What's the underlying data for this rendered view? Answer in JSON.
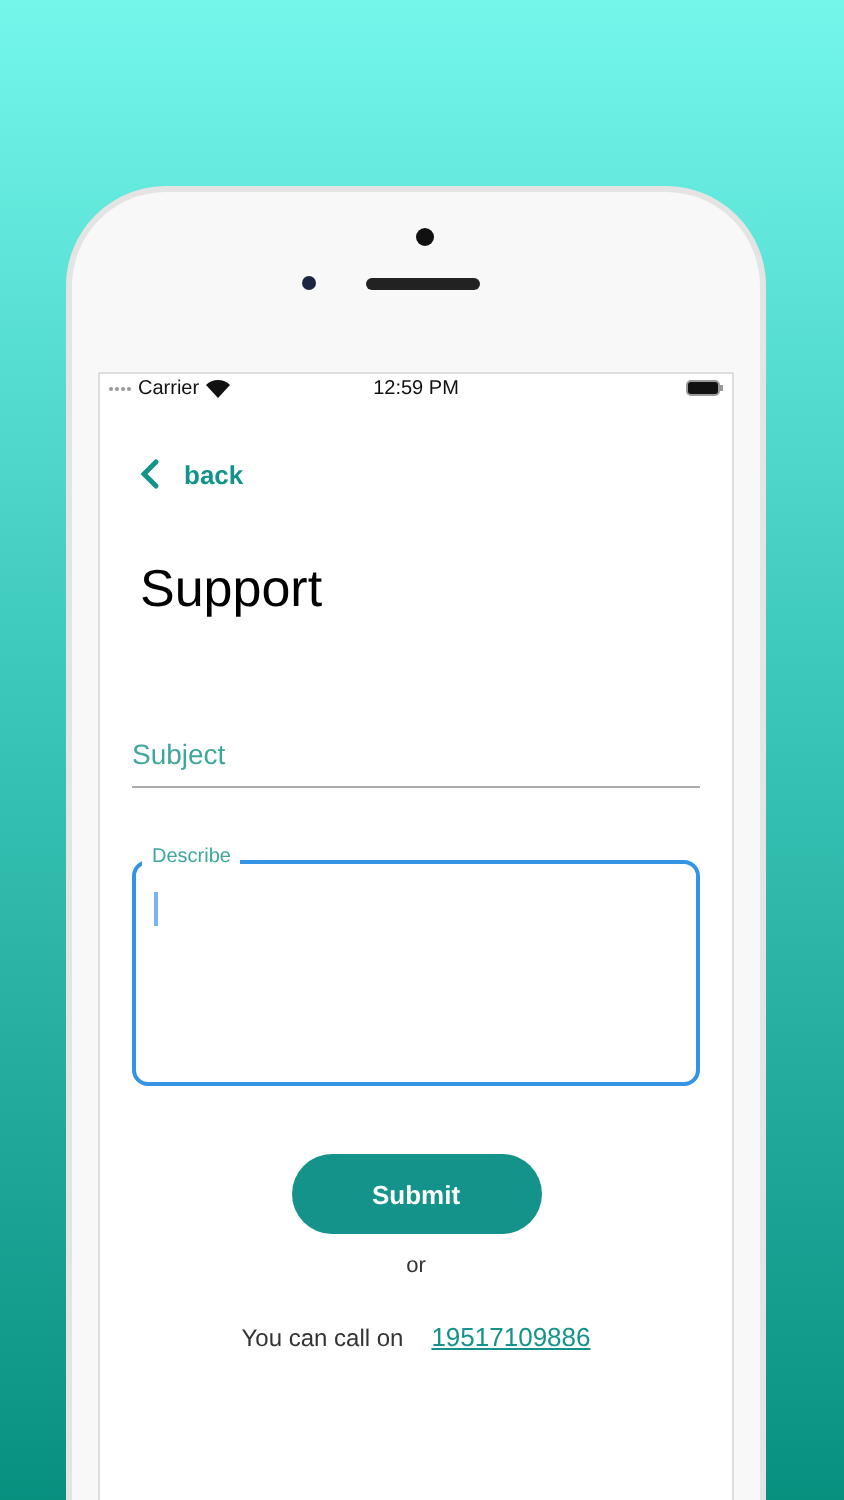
{
  "status_bar": {
    "carrier": "Carrier",
    "time": "12:59 PM"
  },
  "back": {
    "label": "back"
  },
  "title": "Support",
  "subject": {
    "placeholder": "Subject"
  },
  "describe": {
    "label": "Describe",
    "focused": true
  },
  "submit": "Submit",
  "or": "or",
  "call": {
    "text": "You can call on",
    "phone": "19517109886"
  }
}
